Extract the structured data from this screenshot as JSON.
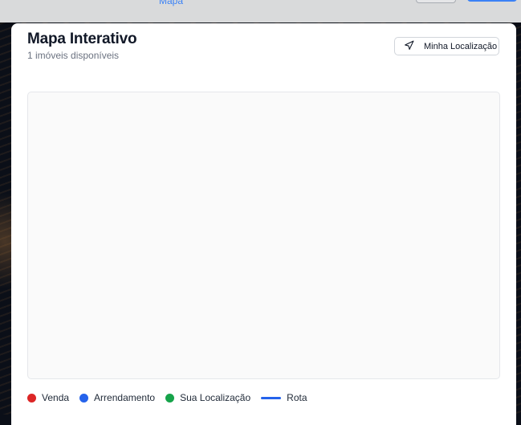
{
  "topbar": {
    "active_nav_label": "Mapa"
  },
  "header": {
    "title": "Mapa Interativo",
    "subtitle": "1 imóveis disponíveis",
    "location_button_label": "Minha Localização"
  },
  "legend": [
    {
      "label": "Venda",
      "color": "#dc2626",
      "kind": "dot"
    },
    {
      "label": "Arrendamento",
      "color": "#2563eb",
      "kind": "dot"
    },
    {
      "label": "Sua Localização",
      "color": "#16a34a",
      "kind": "dot"
    },
    {
      "label": "Rota",
      "color": "#2563eb",
      "kind": "line"
    }
  ],
  "icons": {
    "location_button_icon": "navigation-arrow-icon"
  }
}
